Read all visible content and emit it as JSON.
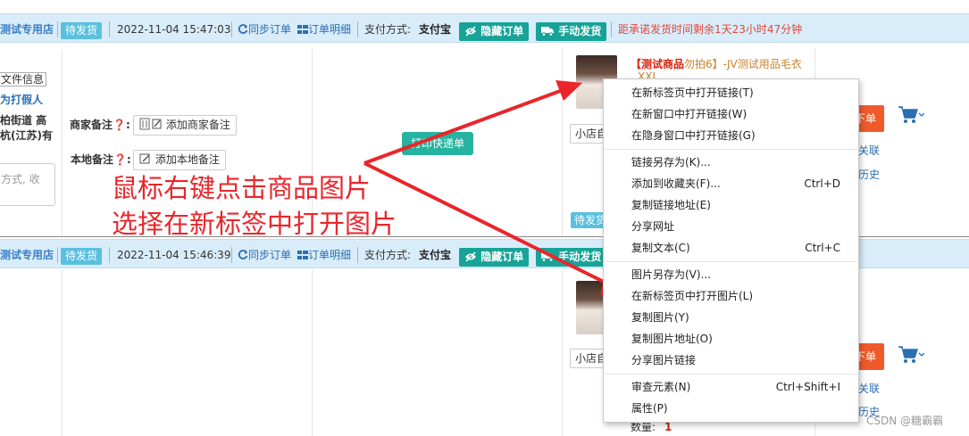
{
  "orders": [
    {
      "shop": "测试专用店",
      "status": "待发货",
      "time": "2022-11-04 15:47:03",
      "sync_label": "同步订单",
      "detail_label": "订单明细",
      "pay_label": "支付方式:",
      "pay_value": "支付宝",
      "hide_label": "隐藏订单",
      "ship_label": "手动发货",
      "countdown": "距承诺发货时间剩余1天23小时47分钟"
    },
    {
      "shop": "测试专用店",
      "status": "待发货",
      "time": "2022-11-04 15:46:39",
      "sync_label": "同步订单",
      "detail_label": "订单明细",
      "pay_label": "支付方式:",
      "pay_value": "支付宝",
      "hide_label": "隐藏订单",
      "ship_label": "手动发货"
    }
  ],
  "left_panel": {
    "line1": "文件信息",
    "line2": "为打假人",
    "line3": "柏街道 高",
    "line4": "杭(江苏)有",
    "textarea_placeholder": "方式, 收"
  },
  "notes": {
    "merchant_label": "商家备注",
    "merchant_button": "添加商家备注",
    "local_label": "本地备注",
    "local_button": "添加本地备注"
  },
  "print_button": "打印快递单",
  "product": {
    "title_tag": "【测试商品",
    "title_rest": "勿拍6】-JV测试用品毛衣",
    "title_line2": "XXL",
    "shop_select": "小店自",
    "pending_tag": "待发货",
    "order_button": "下单",
    "link_related": "关联",
    "link_history": "历史",
    "qty_label": "数量:",
    "qty_value": "1"
  },
  "annotation": {
    "line1": "鼠标右键点击商品图片",
    "line2": "选择在新标签中打开图片"
  },
  "context_menu": {
    "items": [
      {
        "label": "在新标签页中打开链接(T)",
        "shortcut": ""
      },
      {
        "label": "在新窗口中打开链接(W)",
        "shortcut": ""
      },
      {
        "label": "在隐身窗口中打开链接(G)",
        "shortcut": ""
      },
      {
        "label": "链接另存为(K)...",
        "shortcut": ""
      },
      {
        "label": "添加到收藏夹(F)...",
        "shortcut": "Ctrl+D"
      },
      {
        "label": "复制链接地址(E)",
        "shortcut": ""
      },
      {
        "label": "分享网址",
        "shortcut": ""
      },
      {
        "label": "复制文本(C)",
        "shortcut": "Ctrl+C"
      },
      {
        "label": "图片另存为(V)...",
        "shortcut": ""
      },
      {
        "label": "在新标签页中打开图片(L)",
        "shortcut": ""
      },
      {
        "label": "复制图片(Y)",
        "shortcut": ""
      },
      {
        "label": "复制图片地址(O)",
        "shortcut": ""
      },
      {
        "label": "分享图片链接",
        "shortcut": ""
      },
      {
        "label": "审查元素(N)",
        "shortcut": "Ctrl+Shift+I"
      },
      {
        "label": "属性(P)",
        "shortcut": ""
      }
    ]
  },
  "watermark": "CSDN @糖霸霸",
  "colors": {
    "header_bg": "#d9ecf9",
    "accent_green": "#17a398",
    "badge_blue": "#5bc0de",
    "link_blue": "#2a6fb3",
    "warning_red": "#e0473a",
    "annotation_red": "#e8262b",
    "order_orange": "#f05a2a"
  },
  "icons": {
    "sync": "refresh-icon",
    "detail": "grid-icon",
    "hide": "eye-icon",
    "ship": "truck-icon",
    "note": "edit-icon",
    "cart": "cart-icon"
  }
}
